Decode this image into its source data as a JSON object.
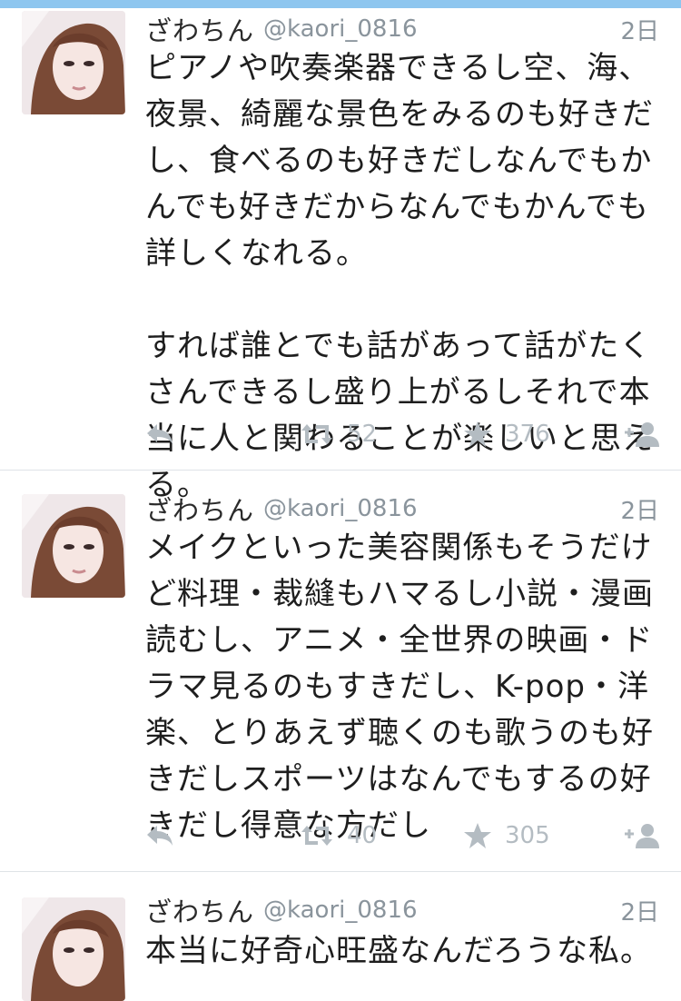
{
  "tweets": [
    {
      "name": "ざわちん",
      "handle": "@kaori_0816",
      "time": "2日",
      "text": "ピアノや吹奏楽器できるし空、海、夜景、綺麗な景色をみるのも好きだし、食べるのも好きだしなんでもかんでも好きだからなんでもかんでも詳しくなれる。\n\nすれば誰とでも話があって話がたくさんできるし盛り上がるしそれで本当に人と関わることが楽しいと思える。",
      "retweets": "52",
      "favorites": "376"
    },
    {
      "name": "ざわちん",
      "handle": "@kaori_0816",
      "time": "2日",
      "text": "メイクといった美容関係もそうだけど料理・裁縫もハマるし小説・漫画読むし、アニメ・全世界の映画・ドラマ見るのもすきだし、K-pop・洋楽、とりあえず聴くのも歌うのも好きだしスポーツはなんでもするの好きだし得意な方だし",
      "retweets": "40",
      "favorites": "305"
    },
    {
      "name": "ざわちん",
      "handle": "@kaori_0816",
      "time": "2日",
      "text": "本当に好奇心旺盛なんだろうな私。"
    }
  ],
  "icons": {
    "reply": "reply-icon",
    "retweet": "retweet-icon",
    "favorite": "star-icon",
    "follow": "follow-icon"
  },
  "colors": {
    "top_bar": "#8ec6ef",
    "text": "#1e1e1e",
    "meta": "#8a949c",
    "action": "#b4bcc2"
  }
}
